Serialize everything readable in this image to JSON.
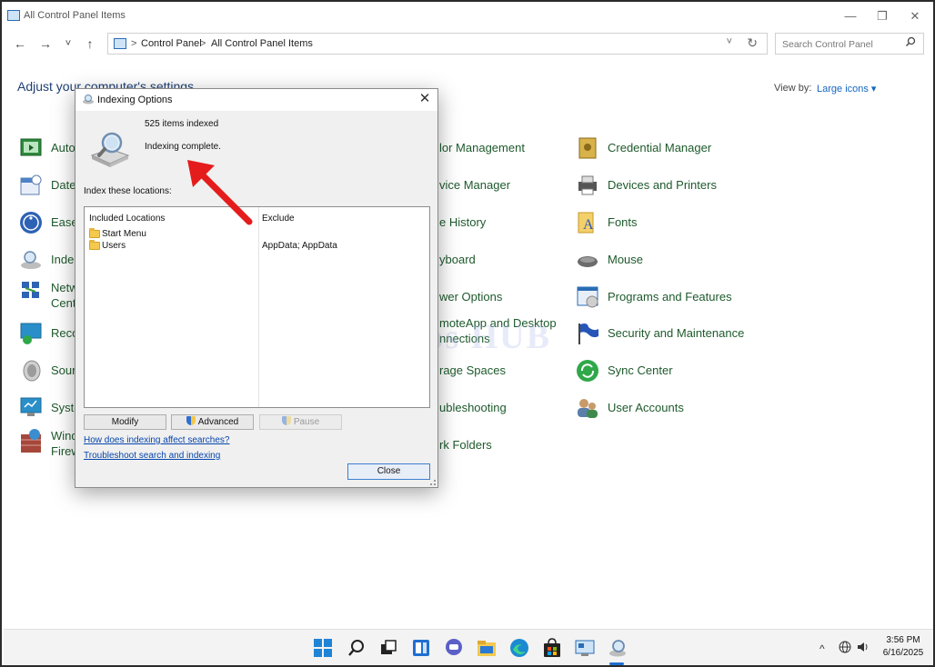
{
  "window": {
    "title": "All Control Panel Items",
    "controls": {
      "minimize": "—",
      "restore": "❐",
      "close": "✕"
    }
  },
  "nav": {
    "back": "←",
    "forward": "→",
    "recent": "˅",
    "up": "↑"
  },
  "address": {
    "crumbs": [
      "Control Panel",
      "All Control Panel Items"
    ],
    "separator": ">",
    "dropdown": "˅",
    "refresh": "↻"
  },
  "search": {
    "placeholder": "Search Control Panel"
  },
  "page": {
    "heading": "Adjust your computer's settings",
    "view_by_label": "View by:",
    "view_by_value": "Large icons ▾"
  },
  "items_left": [
    {
      "label": "Auto",
      "icon": "autoplay-icon"
    },
    {
      "label": "Date",
      "icon": "date-time-icon"
    },
    {
      "label": "Ease",
      "icon": "ease-of-access-icon"
    },
    {
      "label": "Inde",
      "icon": "indexing-icon"
    },
    {
      "label": "Netw",
      "label2": "Cent",
      "icon": "network-icon"
    },
    {
      "label": "Reco",
      "icon": "recovery-icon"
    },
    {
      "label": "Soun",
      "icon": "sound-icon"
    },
    {
      "label": "Syste",
      "icon": "system-icon"
    },
    {
      "label": "Wind",
      "label2": "Firew",
      "icon": "firewall-icon"
    }
  ],
  "items_middle": [
    {
      "label": "lor Management"
    },
    {
      "label": "vice Manager"
    },
    {
      "label": "e History"
    },
    {
      "label": "yboard"
    },
    {
      "label": "wer Options"
    },
    {
      "label": "moteApp and Desktop",
      "label2": "nnections"
    },
    {
      "label": "rage Spaces"
    },
    {
      "label": "ubleshooting"
    },
    {
      "label": "rk Folders"
    }
  ],
  "items_right": [
    {
      "label": "Credential Manager",
      "icon": "credential-manager-icon",
      "color": "#c9a23a"
    },
    {
      "label": "Devices and Printers",
      "icon": "printer-icon",
      "color": "#555555"
    },
    {
      "label": "Fonts",
      "icon": "fonts-icon",
      "color": "#e0b84a"
    },
    {
      "label": "Mouse",
      "icon": "mouse-icon",
      "color": "#6b6b6b"
    },
    {
      "label": "Programs and Features",
      "icon": "programs-icon",
      "color": "#2a6db5"
    },
    {
      "label": "Security and Maintenance",
      "icon": "flag-icon",
      "color": "#2856b8"
    },
    {
      "label": "Sync Center",
      "icon": "sync-icon",
      "color": "#2fa84a"
    },
    {
      "label": "User Accounts",
      "icon": "users-icon",
      "color": "#5a7fa8"
    }
  ],
  "watermark": "IT Pros HUB",
  "dialog": {
    "title": "Indexing Options",
    "items_indexed": "525 items indexed",
    "status": "Indexing complete.",
    "locations_label": "Index these locations:",
    "col_included": "Included Locations",
    "col_exclude": "Exclude",
    "rows": [
      {
        "location": "Start Menu",
        "exclude": ""
      },
      {
        "location": "Users",
        "exclude": "AppData; AppData"
      }
    ],
    "modify": "Modify",
    "advanced": "Advanced",
    "pause": "Pause",
    "link1": "How does indexing affect searches?",
    "link2": "Troubleshoot search and indexing",
    "close": "Close"
  },
  "taskbar": {
    "clock_time": "3:56 PM",
    "clock_date": "6/16/2025",
    "tray_chevron": "^",
    "tray_network": "🌐",
    "tray_volume": "🔊"
  },
  "colors": {
    "accent": "#1566c0",
    "item_text": "#1e5a2c",
    "arrow": "#e51c1c"
  }
}
